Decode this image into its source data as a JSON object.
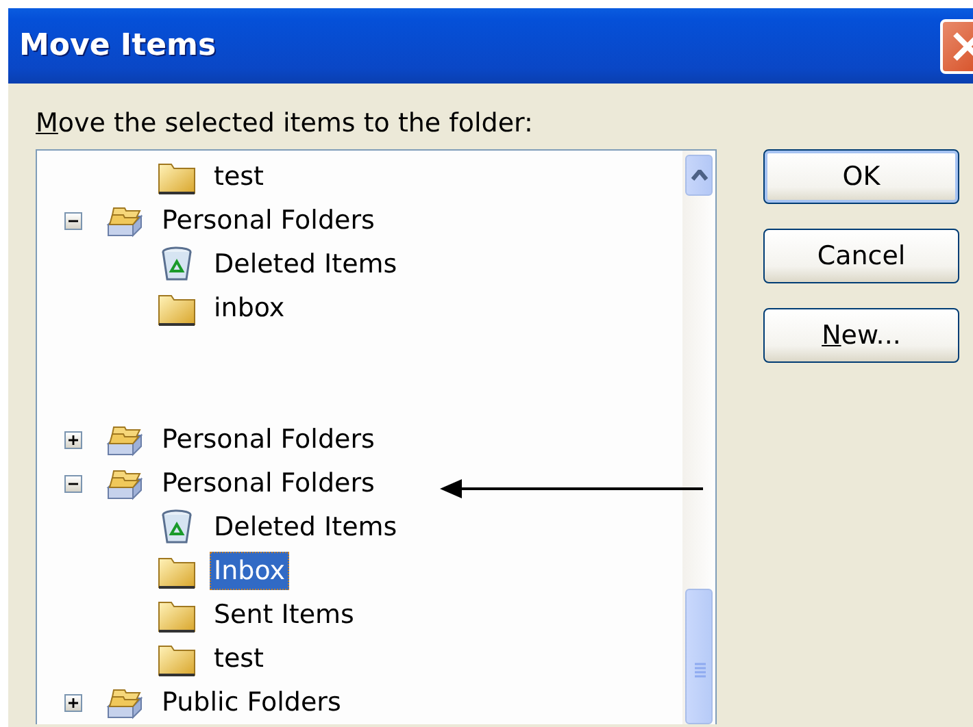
{
  "window": {
    "title": "Move Items"
  },
  "prompt": {
    "label": "Move the selected items to the folder:",
    "mnemonic_underlined": true
  },
  "tree": {
    "partial_branch": [
      {
        "kind": "folder",
        "label": "test",
        "selected": false
      }
    ],
    "items": [
      {
        "kind": "store",
        "label": "Personal Folders",
        "expanded": true,
        "selected": false,
        "children": [
          {
            "kind": "trash",
            "label": "Deleted Items",
            "selected": false
          },
          {
            "kind": "folder",
            "label": "inbox",
            "selected": false
          }
        ]
      },
      {
        "kind": "store",
        "label": "Personal Folders",
        "expanded": false,
        "selected": false
      },
      {
        "kind": "store",
        "label": "Personal Folders",
        "expanded": true,
        "selected": false,
        "children": [
          {
            "kind": "trash",
            "label": "Deleted Items",
            "selected": false
          },
          {
            "kind": "folder",
            "label": "Inbox",
            "selected": true
          },
          {
            "kind": "folder",
            "label": "Sent Items",
            "selected": false
          },
          {
            "kind": "folder",
            "label": "test",
            "selected": false
          }
        ]
      },
      {
        "kind": "store",
        "label": "Public Folders",
        "expanded": false,
        "selected": false
      }
    ]
  },
  "buttons": [
    {
      "label": "OK",
      "default": true,
      "mnemonic_underlined": false
    },
    {
      "label": "Cancel",
      "default": false,
      "mnemonic_underlined": false
    },
    {
      "label": "New...",
      "default": false,
      "mnemonic_underlined": true
    }
  ]
}
